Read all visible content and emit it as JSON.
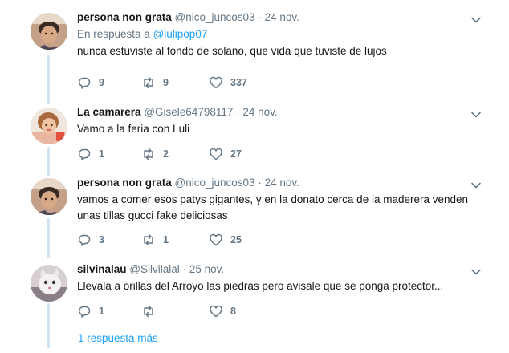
{
  "tweets": [
    {
      "name": "persona non grata",
      "handle": "@nico_juncos03",
      "dot": "·",
      "time": "24 nov.",
      "reply_prefix": "En respuesta a",
      "reply_mention": "@lulipop07",
      "text": "nunca estuviste al fondo de solano, que vida que tuviste de lujos",
      "replies": "9",
      "retweets": "9",
      "likes": "337"
    },
    {
      "name": "La camarera",
      "handle": "@Gisele64798117",
      "dot": "·",
      "time": "24 nov.",
      "text": "Vamo a la feria con Luli",
      "replies": "1",
      "retweets": "2",
      "likes": "27"
    },
    {
      "name": "persona non grata",
      "handle": "@nico_juncos03",
      "dot": "·",
      "time": "24 nov.",
      "text": "vamos a comer esos patys gigantes, y en la donato cerca de la maderera venden unas tillas gucci fake deliciosas",
      "replies": "3",
      "retweets": "1",
      "likes": "25"
    },
    {
      "name": "silvinalau",
      "handle": "@Silvilalal",
      "dot": "·",
      "time": "25 nov.",
      "text": "Llevala a orillas del Arroyo las piedras pero avisale que se ponga protector...",
      "replies": "1",
      "retweets": "",
      "likes": "8"
    }
  ],
  "more_replies": "1 respuesta más",
  "colors": {
    "accent": "#1da1f2",
    "muted": "#657786",
    "thread": "#cfe3f2"
  }
}
